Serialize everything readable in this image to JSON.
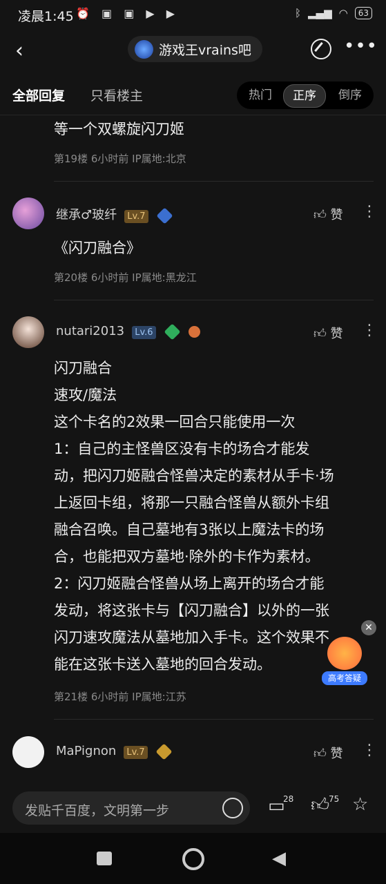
{
  "status_bar": {
    "time": "凌晨1:45",
    "battery": "63"
  },
  "nav": {
    "forum_name": "游戏王vrains吧"
  },
  "tabs": {
    "all": "全部回复",
    "op_only": "只看楼主",
    "sort": [
      "热门",
      "正序",
      "倒序"
    ],
    "sort_active": "正序"
  },
  "posts": [
    {
      "text": "等一个双螺旋闪刀姬",
      "meta": "第19楼  6小时前  IP属地:北京"
    },
    {
      "user": "继承♂玻纤",
      "level": "Lv.7",
      "badge_num": "9",
      "text": "《闪刀融合》",
      "meta": "第20楼  6小时前  IP属地:黑龙江",
      "like": "赞"
    },
    {
      "user": "nutari2013",
      "level": "Lv.6",
      "badge_num": "1",
      "badge2_num": "3",
      "lines": [
        "闪刀融合",
        "速攻/魔法",
        "这个卡名的2效果一回合只能使用一次",
        "1：自己的主怪兽区没有卡的场合才能发",
        "动，把闪刀姬融合怪兽决定的素材从手卡·场",
        "上返回卡组，将那一只融合怪兽从额外卡组",
        "融合召唤。自己墓地有3张以上魔法卡的场",
        "合，也能把双方墓地·除外的卡作为素材。",
        "2：闪刀姬融合怪兽从场上离开的场合才能",
        "发动，将这张卡与【闪刀融合】以外的一张",
        "闪刀速攻魔法从墓地加入手卡。这个效果不",
        "能在这张卡送入墓地的回合发动。"
      ],
      "meta": "第21楼  6小时前  IP属地:江苏",
      "like": "赞"
    },
    {
      "user": "MaPignon",
      "level": "Lv.7",
      "badge_num": "11",
      "like": "赞"
    }
  ],
  "float_ad": {
    "label": "高考答疑"
  },
  "bottom": {
    "placeholder": "发贴千百度，文明第一步",
    "comments": "28",
    "likes": "75"
  }
}
